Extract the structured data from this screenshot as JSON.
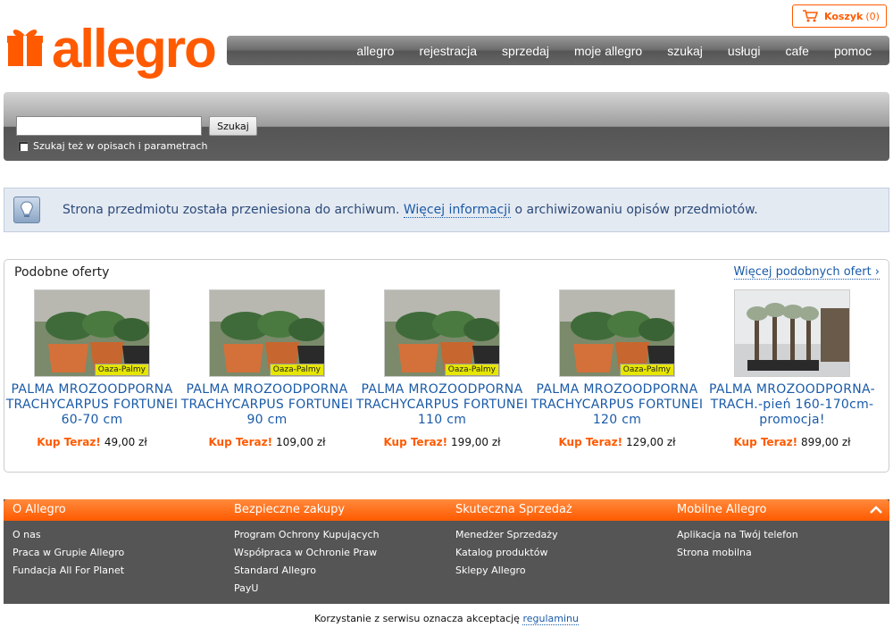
{
  "header": {
    "logo_text": "allegro",
    "cart": {
      "label": "Koszyk",
      "count": "(0)"
    },
    "nav": [
      "allegro",
      "rejestracja",
      "sprzedaj",
      "moje allegro",
      "szukaj",
      "usługi",
      "cafe",
      "pomoc"
    ]
  },
  "search": {
    "button_label": "Szukaj",
    "placeholder": "",
    "checkbox_label": "Szukaj też w opisach i parametrach"
  },
  "info": {
    "text_before": "Strona przedmiotu została przeniesiona do archiwum.",
    "link": "Więcej informacji",
    "text_after": "o archiwizowaniu opisów przedmiotów."
  },
  "similar": {
    "title": "Podobne oferty",
    "more_link": "Więcej podobnych ofert ›",
    "buy_label": "Kup Teraz!",
    "badge": "Oaza-Palmy",
    "offers": [
      {
        "name": "PALMA MROZOODPORNA TRACHYCARPUS FORTUNEI 60-70 cm",
        "price": "49,00 zł"
      },
      {
        "name": "PALMA MROZOODPORNA TRACHYCARPUS FORTUNEI 90 cm",
        "price": "109,00 zł"
      },
      {
        "name": "PALMA MROZOODPORNA TRACHYCARPUS FORTUNEI 110 cm",
        "price": "199,00 zł"
      },
      {
        "name": "PALMA MROZOODPORNA TRACHYCARPUS FORTUNEI 120 cm",
        "price": "129,00 zł"
      },
      {
        "name": "PALMA MROZOODPORNA-TRACH.-pień 160-170cm-promocja!",
        "price": "899,00 zł"
      }
    ]
  },
  "footer": {
    "columns": [
      {
        "title": "O Allegro",
        "items": [
          "O nas",
          "Praca w Grupie Allegro",
          "Fundacja All For Planet"
        ]
      },
      {
        "title": "Bezpieczne zakupy",
        "items": [
          "Program Ochrony Kupujących",
          "Współpraca w Ochronie Praw",
          "Standard Allegro",
          "PayU"
        ]
      },
      {
        "title": "Skuteczna Sprzedaż",
        "items": [
          "Menedżer Sprzedaży",
          "Katalog produktów",
          "Sklepy Allegro"
        ]
      },
      {
        "title": "Mobilne Allegro",
        "items": [
          "Aplikacja na Twój telefon",
          "Strona mobilna"
        ]
      }
    ],
    "terms_text": "Korzystanie z serwisu oznacza akceptację",
    "terms_link": "regulaminu"
  },
  "colors": {
    "brand": "#ff5a00",
    "link": "#1a5aa8",
    "footer_bg": "#555555"
  }
}
